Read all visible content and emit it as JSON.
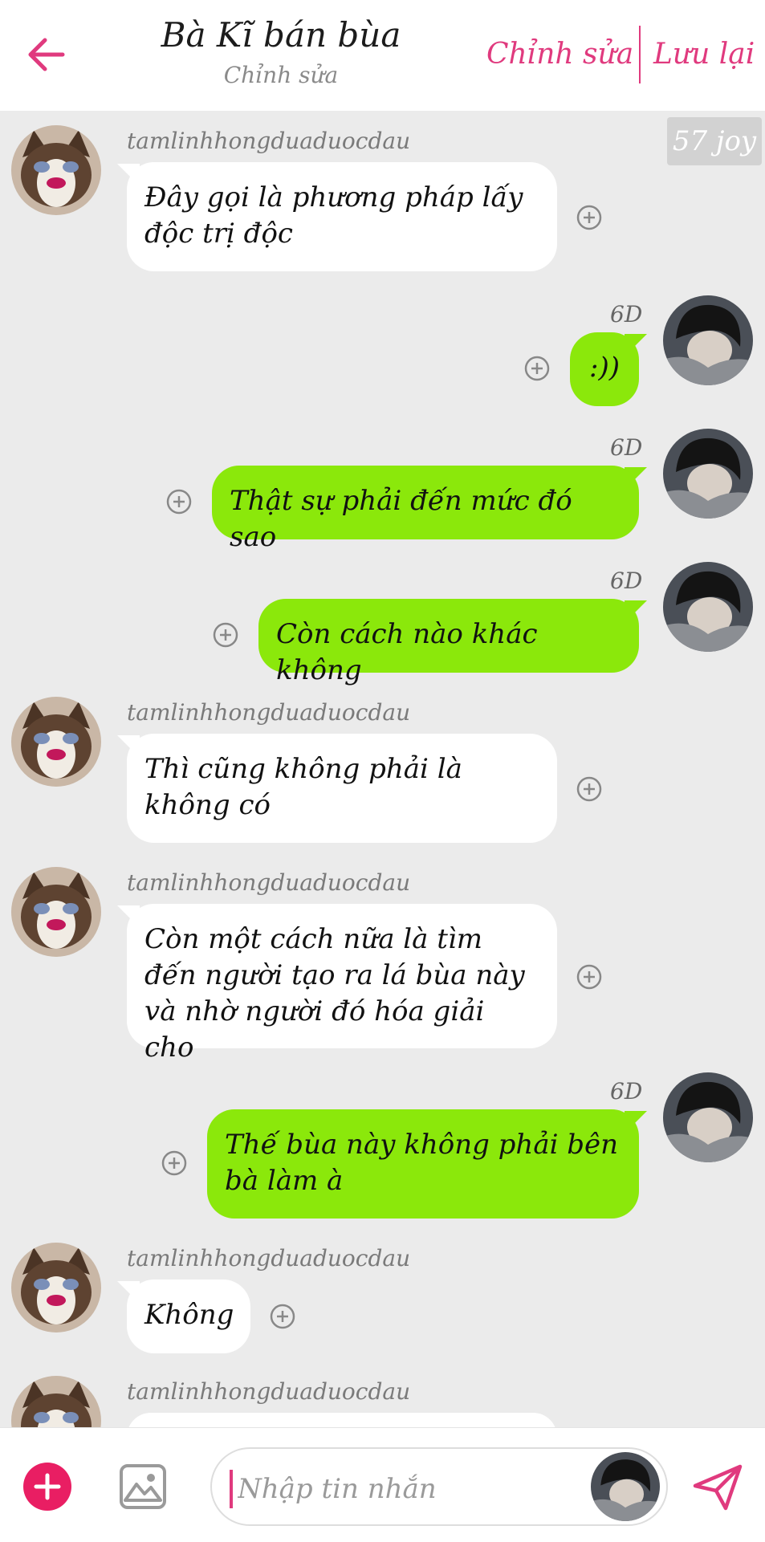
{
  "header": {
    "title": "Bà Kĩ bán bùa",
    "subtitle": "Chỉnh sửa",
    "edit_label": "Chỉnh sửa",
    "save_label": "Lưu lại",
    "accent_color": "#e03a7e"
  },
  "chat": {
    "badge": "57 joy",
    "other_name": "tamlinhhongduaduocdau",
    "my_name": "6D",
    "messages": [
      {
        "from": "them",
        "text": "Đây gọi là phương pháp lấy độc trị độc"
      },
      {
        "from": "me",
        "text": ":))"
      },
      {
        "from": "me",
        "text": "Thật sự phải đến mức đó sao"
      },
      {
        "from": "me",
        "text": "Còn cách nào khác không"
      },
      {
        "from": "them",
        "text": "Thì cũng không phải là không có"
      },
      {
        "from": "them",
        "text": "Còn một cách nữa là tìm đến người tạo ra lá bùa này và nhờ người đó hóa giải cho"
      },
      {
        "from": "me",
        "text": "Thế bùa này không phải bên bà làm à"
      },
      {
        "from": "them",
        "text": "Không"
      },
      {
        "from": "them",
        "text": ""
      }
    ],
    "incoming_bubble_color": "#ffffff",
    "outgoing_bubble_color": "#8be80b"
  },
  "composer": {
    "placeholder": "Nhập tin nhắn",
    "value": ""
  },
  "icons": {
    "back": "back-arrow-icon",
    "add": "plus-circle-icon",
    "image": "image-icon",
    "send": "send-icon",
    "message_action": "plus-circle-outline-icon"
  }
}
